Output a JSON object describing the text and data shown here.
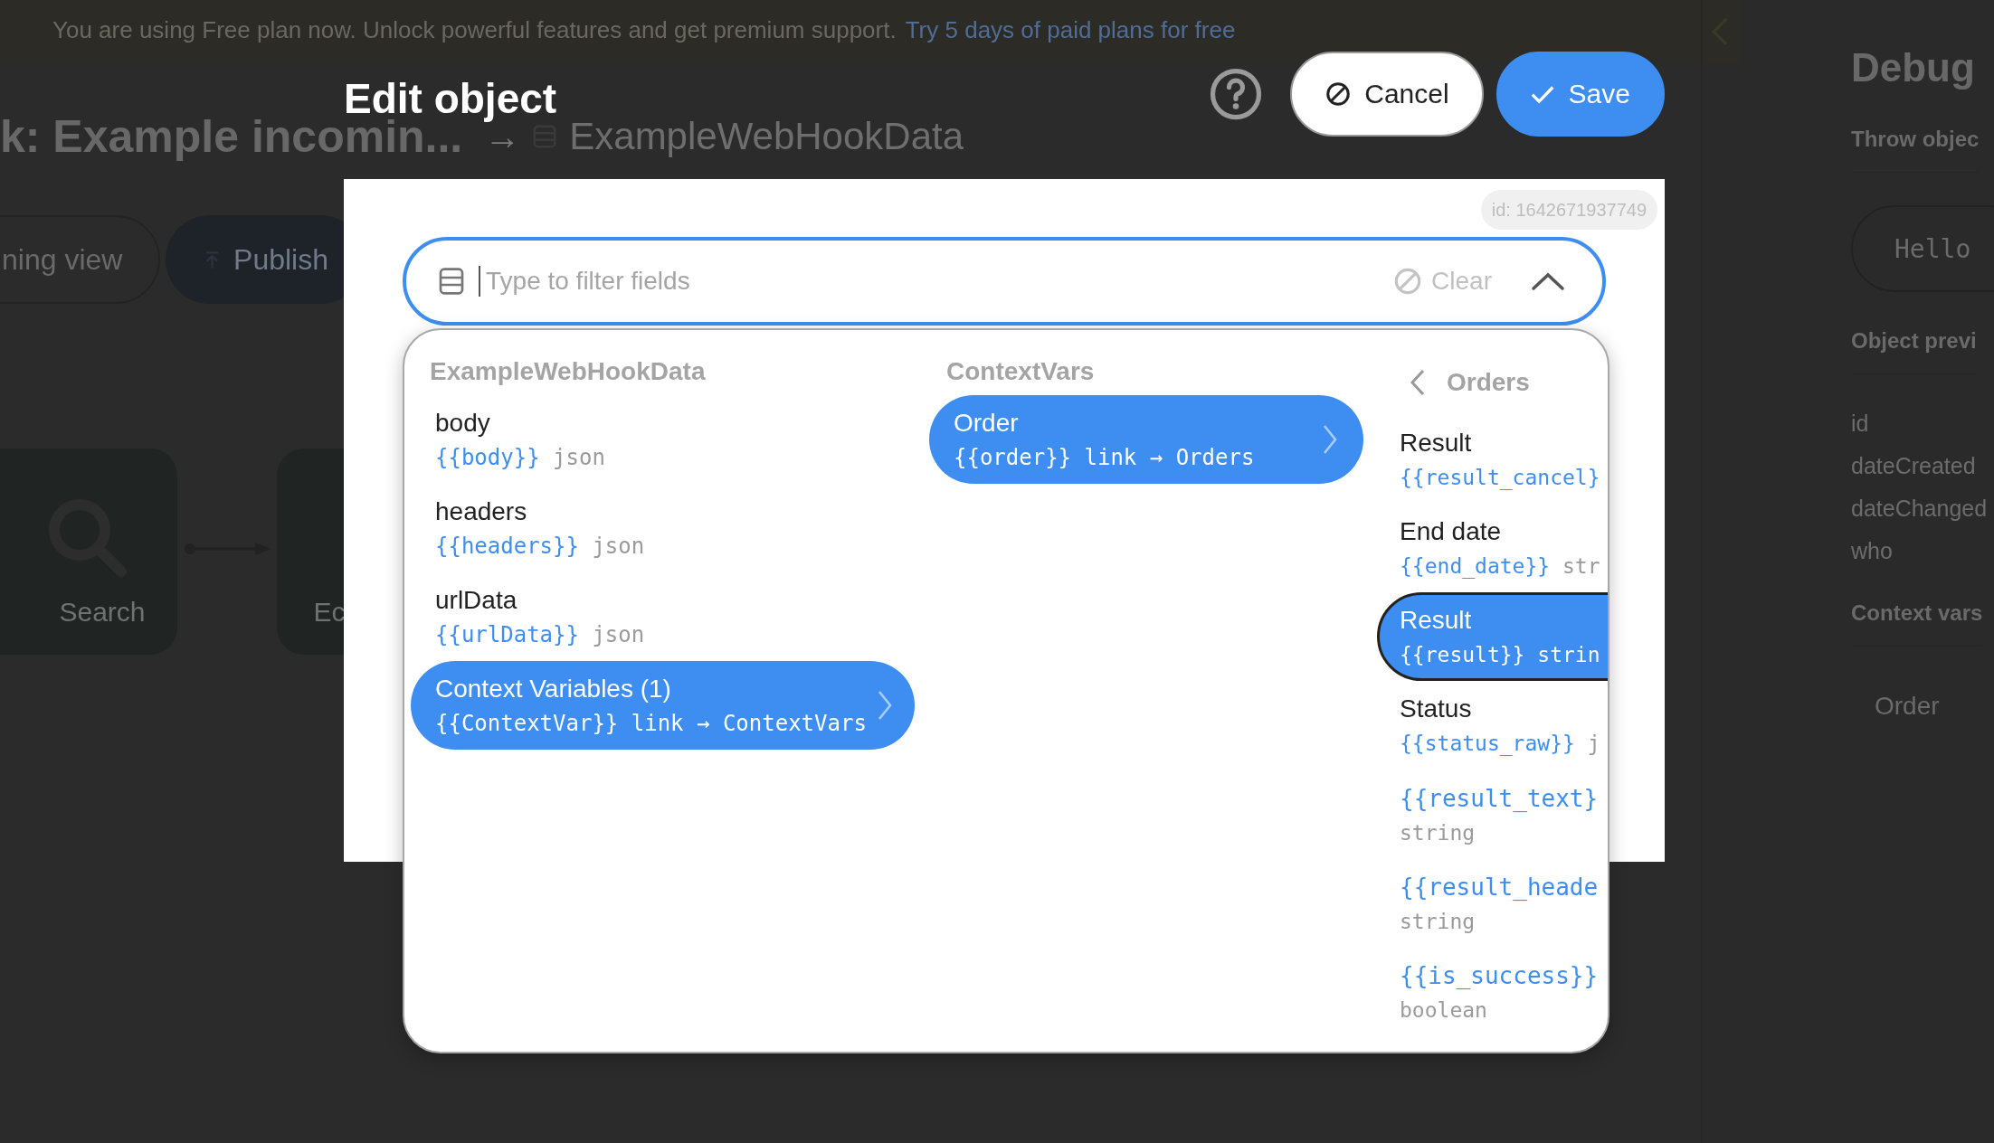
{
  "banner": {
    "text": "You are using Free plan now. Unlock powerful features and get premium support.",
    "link": "Try 5 days of paid plans for free"
  },
  "page": {
    "title": "k: Example incomin...",
    "arrow": "→",
    "target": "ExampleWebHookData"
  },
  "toolbar": [
    {
      "label": "ning view",
      "kind": "outline"
    },
    {
      "label": "Publish",
      "kind": "primary"
    }
  ],
  "canvas_nodes": [
    {
      "label": "Search",
      "kind": "search"
    },
    {
      "label": "Ec",
      "kind": "plain"
    }
  ],
  "debug_panel": {
    "title": "Debug",
    "section_1": "Throw objec",
    "button": "Hello",
    "section_2": "Object previ",
    "fields": [
      "id",
      "dateCreated",
      "dateChanged",
      "who"
    ],
    "section_3": "Context vars",
    "context_items": [
      "Order"
    ]
  },
  "dialog": {
    "title": "Edit object",
    "buttons": [
      {
        "label": "Cancel",
        "kind": "cancel"
      },
      {
        "label": "Save",
        "kind": "save"
      }
    ],
    "id_badge": "id: 1642671937749",
    "filter": {
      "placeholder": "Type to filter fields",
      "clear": "Clear",
      "expanded": true
    },
    "columns": [
      {
        "title": "ExampleWebHookData",
        "back": false,
        "items": [
          {
            "kind": "field",
            "label": "body",
            "var": "{{body}}",
            "type": "json",
            "selected": false,
            "focused": false,
            "linked": false
          },
          {
            "kind": "field",
            "label": "headers",
            "var": "{{headers}}",
            "type": "json",
            "selected": false,
            "focused": false,
            "linked": false
          },
          {
            "kind": "field",
            "label": "urlData",
            "var": "{{urlData}}",
            "type": "json",
            "selected": false,
            "focused": false,
            "linked": false
          },
          {
            "kind": "field",
            "label": "Context Variables (1)",
            "var": "{{ContextVar}}",
            "type": "link → ContextVars",
            "selected": true,
            "focused": false,
            "linked": true
          }
        ]
      },
      {
        "title": "ContextVars",
        "back": false,
        "items": [
          {
            "kind": "field",
            "label": "Order",
            "var": "{{order}}",
            "type": "link → Orders",
            "selected": true,
            "focused": false,
            "linked": true
          }
        ]
      },
      {
        "title": "Orders",
        "back": true,
        "items": [
          {
            "kind": "field",
            "label": "Result",
            "var": "{{result_cancel}",
            "selected": false,
            "focused": false,
            "linked": false
          },
          {
            "kind": "field",
            "label": "End date",
            "var": "{{end_date}}",
            "type": "str",
            "selected": false,
            "focused": false,
            "linked": false
          },
          {
            "kind": "field",
            "label": "Result",
            "var": "{{result}}",
            "type": "strin",
            "selected": true,
            "focused": true,
            "linked": false
          },
          {
            "kind": "field",
            "label": "Status",
            "var": "{{status_raw}}",
            "type": "j",
            "selected": false,
            "focused": false,
            "linked": false
          },
          {
            "kind": "var",
            "var": "{{result_text}",
            "type": "string",
            "selected": false,
            "focused": false,
            "linked": false
          },
          {
            "kind": "var",
            "var": "{{result_heade",
            "type": "string",
            "selected": false,
            "focused": false,
            "linked": false
          },
          {
            "kind": "var",
            "var": "{{is_success}}",
            "type": "boolean",
            "selected": false,
            "focused": false,
            "linked": false
          }
        ]
      }
    ]
  }
}
